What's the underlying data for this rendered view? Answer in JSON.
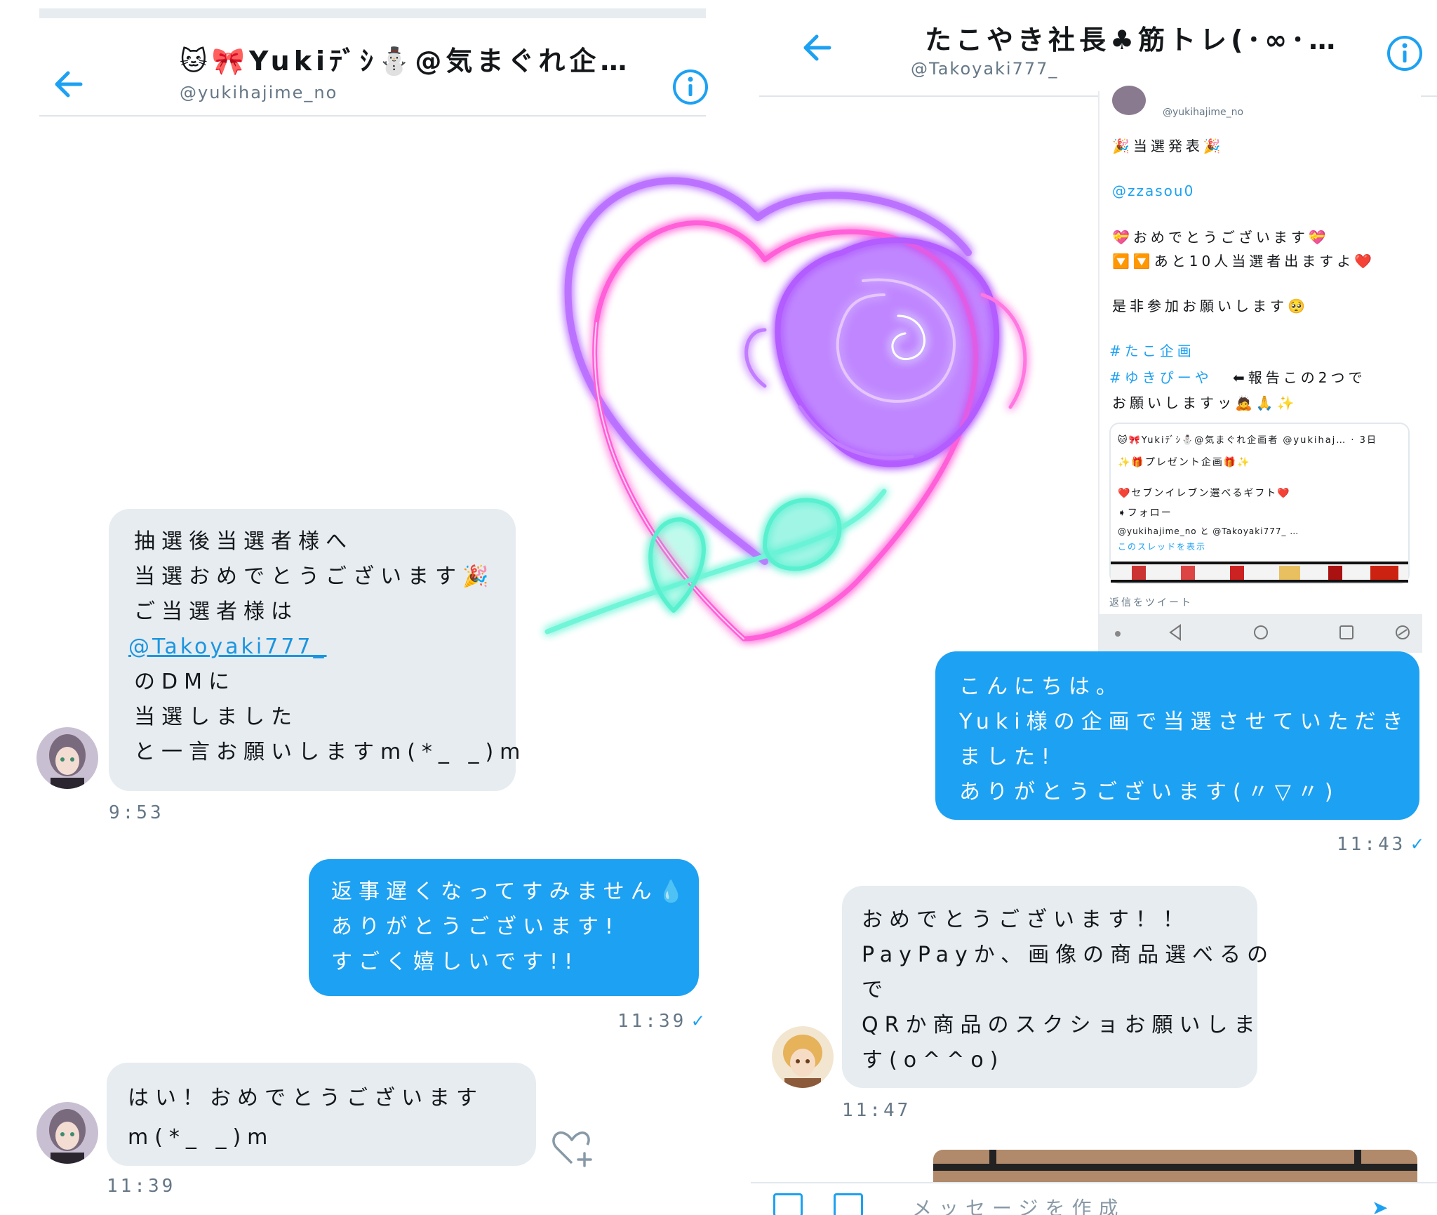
{
  "left": {
    "title": "🐱🎀Yukiﾃﾞｼ⛄@気まぐれ企…",
    "handle": "@yukihajime_no",
    "messages": [
      {
        "lines": [
          "抽選後当選者様へ",
          "当選おめでとうございます🎉",
          "ご当選者様は"
        ],
        "mention": "@Takoyaki777_",
        "lines2": [
          "のDMに",
          "当選しました",
          "と一言お願いしますm(*_ _)m"
        ],
        "time": "9:53"
      },
      {
        "lines": [
          "返事遅くなってすみません💧",
          "ありがとうございます!",
          "すごく嬉しいです!!"
        ],
        "time": "11:39"
      },
      {
        "lines": [
          "はい！おめでとうございます",
          "m(*_ _)m"
        ],
        "time": "11:39"
      }
    ]
  },
  "right": {
    "title": "たこやき社長♣筋トレ(･∞･…",
    "handle": "@Takoyaki777_",
    "embed": {
      "handle": "@yukihajime_no",
      "line1": "🎉当選発表🎉",
      "mention": "@zzasou0",
      "line2": "💝おめでとうございます💝",
      "line3": "🔽🔽あと10人当選者出ますよ❤️",
      "line4": "是非参加お願いします🥺",
      "tag1": "#たこ企画",
      "tag2": "#ゆきぴーや",
      "tag2_note": "⬅報告この2つで",
      "line5": "お願いしますッ🙇🙏✨",
      "card_header": "🐱🎀Yukiﾃﾞｼ⛄@気まぐれ企画者 @yukihaj… · 3日",
      "card_l1": "✨🎁プレゼント企画🎁✨",
      "card_l2": "❤️セブンイレブン選べるギフト❤️",
      "card_l3": "➧フォロー",
      "card_l4": "@yukihajime_no と @Takoyaki777_ …",
      "card_link": "このスレッドを表示",
      "reply": "返信をツイート"
    },
    "messages": [
      {
        "lines": [
          "こんにちは。",
          "Yuki様の企画で当選させていただき",
          "ました!",
          "ありがとうございます(〃▽〃)"
        ],
        "time": "11:43"
      },
      {
        "lines": [
          "おめでとうございます！！",
          "PayPayか、画像の商品選べるの",
          "で",
          "QRか商品のスクショお願いしま",
          "す(o^^o)"
        ],
        "time": "11:47"
      }
    ],
    "composer_placeholder": "メッセージを作成"
  },
  "colors": {
    "accent": "#1da1f2",
    "bubble_in": "#e6ecf0",
    "muted": "#657786"
  },
  "icons": [
    "back-arrow-icon",
    "info-icon",
    "heart-plus-icon",
    "checkmark-icon"
  ]
}
